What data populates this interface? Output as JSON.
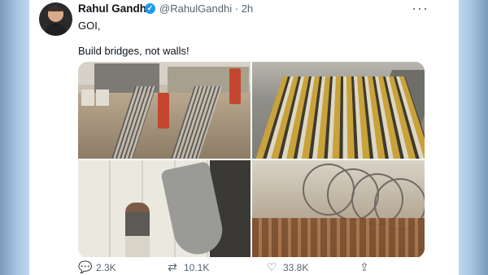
{
  "tweet": {
    "author_name": "Rahul Gandhi",
    "verified_symbol": "✓",
    "handle": "@RahulGandhi",
    "separator": "·",
    "time": "2h",
    "more_symbol": "···",
    "text_line1": "GOI,",
    "text_line2": "Build bridges, not walls!"
  },
  "media": {
    "photos": [
      "road-spikes",
      "aerial-barricades",
      "cement-mixer-worker",
      "razor-wire"
    ]
  },
  "actions": {
    "reply": {
      "icon": "reply-icon",
      "glyph": "💬",
      "count": "2.3K"
    },
    "retweet": {
      "icon": "retweet-icon",
      "glyph": "⇄",
      "count": "10.1K"
    },
    "like": {
      "icon": "heart-icon",
      "glyph": "♡",
      "count": "33.8K"
    },
    "share": {
      "icon": "share-icon",
      "glyph": "⇪"
    }
  },
  "colors": {
    "verified": "#1d9bf0",
    "text": "#0f1419",
    "muted": "#536471",
    "backdrop": "#a9c7e3"
  }
}
